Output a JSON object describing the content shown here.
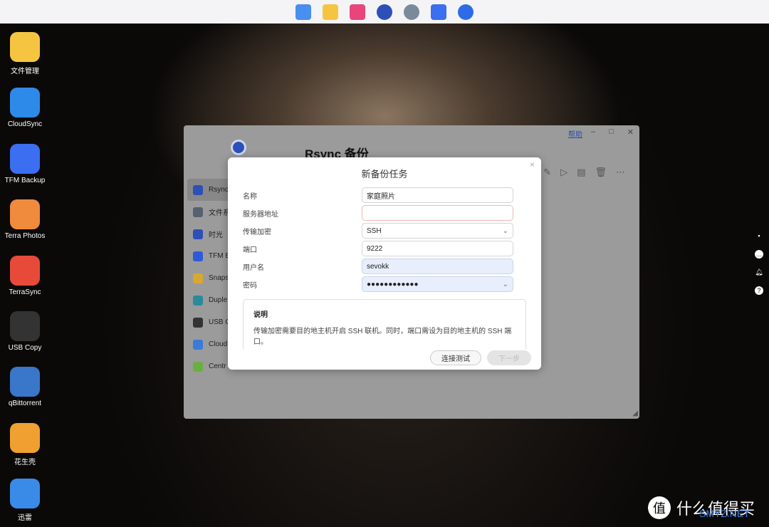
{
  "dock": [
    {
      "icon": "app-center-icon",
      "color": "#4a8ff0"
    },
    {
      "icon": "folder-icon",
      "color": "#f5c542"
    },
    {
      "icon": "photos-app-icon",
      "color": "#e8457a"
    },
    {
      "icon": "rsync-clock-icon",
      "color": "#2d4fb8"
    },
    {
      "icon": "settings-gear-icon",
      "color": "#7a8a9a"
    },
    {
      "icon": "store-bag-icon",
      "color": "#3b6ef0"
    },
    {
      "icon": "support-headset-icon",
      "color": "#2f6be8"
    }
  ],
  "desktop": [
    {
      "label": "文件管理",
      "color": "#f5c542"
    },
    {
      "label": "CloudSync",
      "color": "#2d8ae8"
    },
    {
      "label": "TFM Backup",
      "color": "#3b6ef0"
    },
    {
      "label": "Terra Photos",
      "color": "#f08a3c"
    },
    {
      "label": "TerraSync",
      "color": "#e84a3a"
    },
    {
      "label": "USB Copy",
      "color": "#333333"
    },
    {
      "label": "qBittorrent",
      "color": "#3a76c9"
    },
    {
      "label": "花生壳",
      "color": "#f0a030"
    },
    {
      "label": "迅雷",
      "color": "#3a8ae8"
    }
  ],
  "window": {
    "title": "Rsync 备份",
    "help": "帮助",
    "sidebar": [
      {
        "label": "Rsync",
        "color": "#2d4fb8"
      },
      {
        "label": "文件系",
        "color": "#556070"
      },
      {
        "label": "时光",
        "color": "#2d4fb8"
      },
      {
        "label": "TFM B",
        "color": "#2d5ad8"
      },
      {
        "label": "Snaps",
        "color": "#d9a830"
      },
      {
        "label": "Duple",
        "color": "#2a8a9a"
      },
      {
        "label": "USB C",
        "color": "#333333"
      },
      {
        "label": "Cloud",
        "color": "#3a7ad8"
      },
      {
        "label": "Centr",
        "color": "#6ab040"
      }
    ],
    "toolbar": [
      "edit-icon",
      "play-icon",
      "log-icon",
      "trash-icon",
      "more-icon"
    ]
  },
  "modal": {
    "title": "新备份任务",
    "fields": [
      {
        "label": "名称",
        "value": "家庭照片"
      },
      {
        "label": "服务器地址",
        "value": ""
      },
      {
        "label": "传输加密",
        "value": "SSH"
      },
      {
        "label": "端口",
        "value": "9222"
      },
      {
        "label": "用户名",
        "value": "sevokk"
      },
      {
        "label": "密码",
        "value": "●●●●●●●●●●●●"
      }
    ],
    "note_title": "说明",
    "note_text": "传输加密需要目的地主机开启 SSH 联机。同时，端口需设为目的地主机的 SSH 端口。",
    "test_button": "连接测试",
    "next_button": "下一步"
  },
  "watermark": {
    "text": "什么值得买",
    "badge": "值",
    "site": "SMYZ.NET"
  }
}
